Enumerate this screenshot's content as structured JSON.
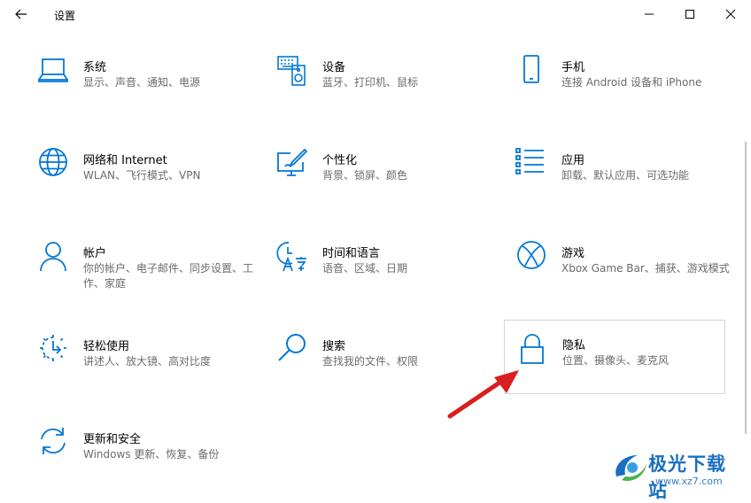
{
  "window": {
    "title": "设置"
  },
  "tiles": [
    {
      "title": "系统",
      "desc": "显示、声音、通知、电源",
      "icon": "laptop-icon"
    },
    {
      "title": "设备",
      "desc": "蓝牙、打印机、鼠标",
      "icon": "keyboard-speaker-icon"
    },
    {
      "title": "手机",
      "desc": "连接 Android 设备和 iPhone",
      "icon": "phone-icon"
    },
    {
      "title": "网络和 Internet",
      "desc": "WLAN、飞行模式、VPN",
      "icon": "globe-icon"
    },
    {
      "title": "个性化",
      "desc": "背景、锁屏、颜色",
      "icon": "paint-monitor-icon"
    },
    {
      "title": "应用",
      "desc": "卸载、默认应用、可选功能",
      "icon": "app-list-icon"
    },
    {
      "title": "帐户",
      "desc": "你的帐户、电子邮件、同步设置、工作、家庭",
      "icon": "person-icon"
    },
    {
      "title": "时间和语言",
      "desc": "语音、区域、日期",
      "icon": "time-language-icon"
    },
    {
      "title": "游戏",
      "desc": "Xbox Game Bar、捕获、游戏模式",
      "icon": "xbox-icon"
    },
    {
      "title": "轻松使用",
      "desc": "讲述人、放大镜、高对比度",
      "icon": "ease-of-access-icon"
    },
    {
      "title": "搜索",
      "desc": "查找我的文件、权限",
      "icon": "search-icon"
    },
    {
      "title": "隐私",
      "desc": "位置、摄像头、麦克风",
      "icon": "lock-icon"
    },
    {
      "title": "更新和安全",
      "desc": "Windows 更新、恢复、备份",
      "icon": "sync-icon"
    }
  ],
  "watermark": {
    "name": "极光下载站",
    "url": "www.xz7.com"
  },
  "colors": {
    "accent": "#0078d7",
    "annotation_arrow": "#d81e1e"
  }
}
